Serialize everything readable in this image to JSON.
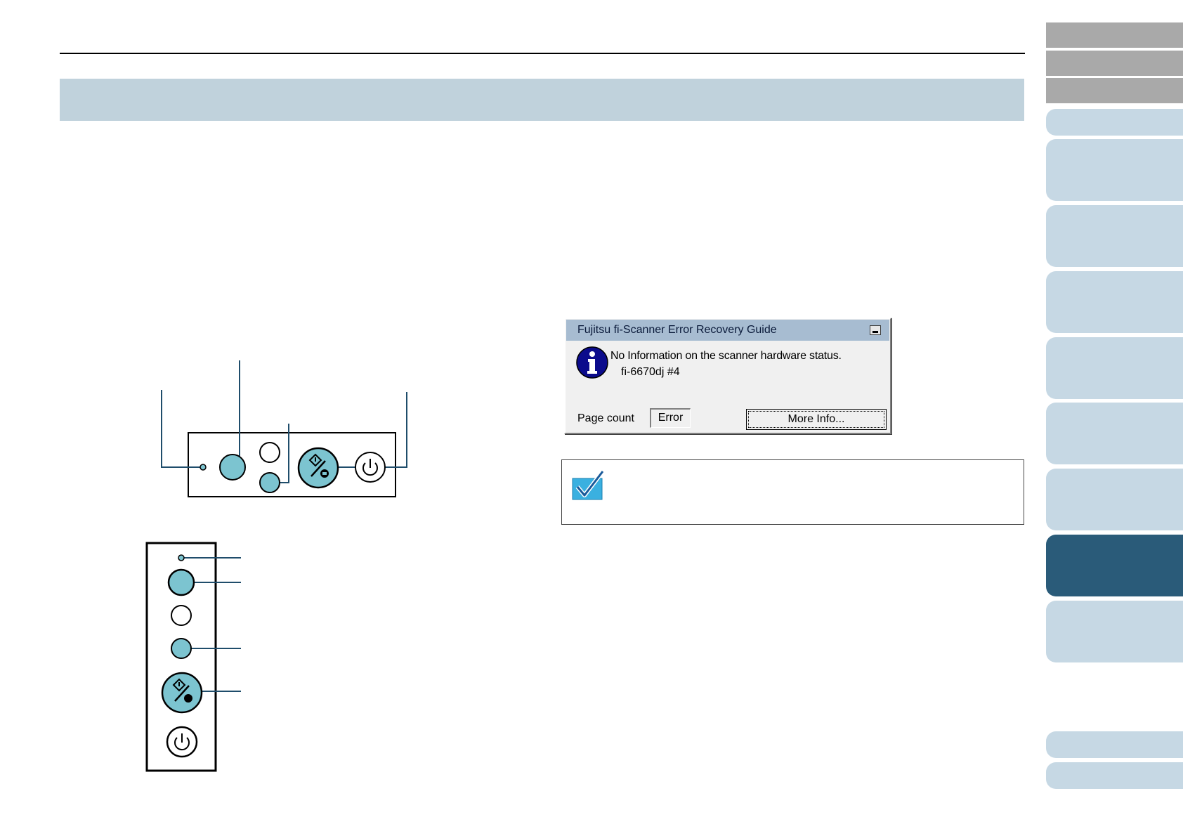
{
  "dialog": {
    "title": "Fujitsu fi-Scanner Error Recovery Guide",
    "message": "No Information on the scanner hardware status.",
    "device": "fi-6670dj #4",
    "page_count_label": "Page count",
    "page_count_value": "Error",
    "more_info_label": "More Info..."
  },
  "colors": {
    "section_band": "#c0d2dc",
    "nav_light": "#c6d8e4",
    "nav_active": "#2a5b79",
    "nav_grey": "#a9a9a9",
    "panel_button": "#7cc4d0",
    "leader_line": "#1f4d6b",
    "dialog_titlebar": "#a7bcd1"
  },
  "icons": {
    "dialog_info": "info-icon",
    "note": "checkmark-icon",
    "panel_scan": "scan-stop-icon",
    "panel_power": "power-icon"
  }
}
